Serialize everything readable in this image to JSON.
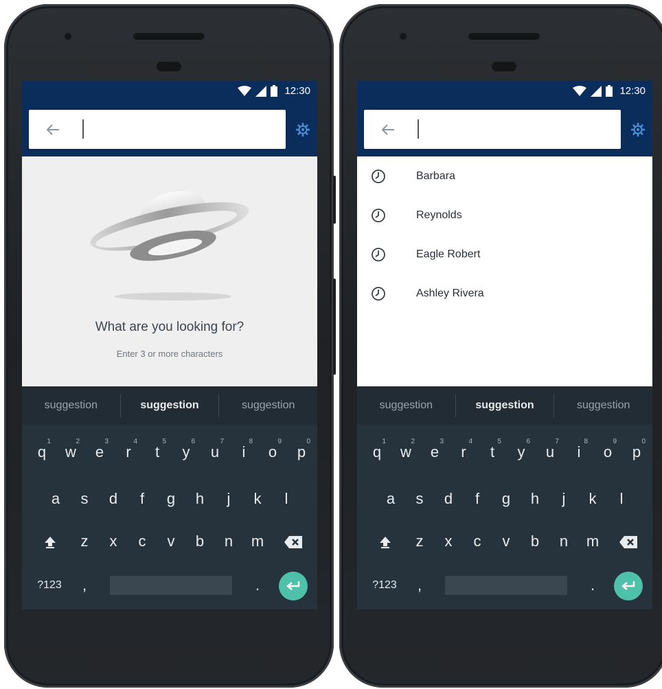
{
  "status": {
    "time": "12:30"
  },
  "left": {
    "empty_title": "What are you looking for?",
    "empty_subtitle": "Enter 3 or more characters"
  },
  "right": {
    "history": [
      {
        "label": "Barbara"
      },
      {
        "label": "Reynolds"
      },
      {
        "label": "Eagle Robert"
      },
      {
        "label": "Ashley Rivera"
      }
    ]
  },
  "suggestions": [
    "suggestion",
    "suggestion",
    "suggestion"
  ],
  "keyboard": {
    "row1": [
      {
        "k": "q",
        "n": "1"
      },
      {
        "k": "w",
        "n": "2"
      },
      {
        "k": "e",
        "n": "3"
      },
      {
        "k": "r",
        "n": "4"
      },
      {
        "k": "t",
        "n": "5"
      },
      {
        "k": "y",
        "n": "6"
      },
      {
        "k": "u",
        "n": "7"
      },
      {
        "k": "i",
        "n": "8"
      },
      {
        "k": "o",
        "n": "9"
      },
      {
        "k": "p",
        "n": "0"
      }
    ],
    "row2": [
      "a",
      "s",
      "d",
      "f",
      "g",
      "h",
      "j",
      "k",
      "l"
    ],
    "row3": [
      "z",
      "x",
      "c",
      "v",
      "b",
      "n",
      "m"
    ],
    "symbols_label": "?123",
    "comma": ",",
    "period": "."
  },
  "colors": {
    "appbar": "#0b2d5c",
    "keyboard_bg": "#27333c",
    "suggestion_bg": "#212c34",
    "enter_key": "#4fc0a9",
    "gear_icon": "#4a8fd8"
  }
}
